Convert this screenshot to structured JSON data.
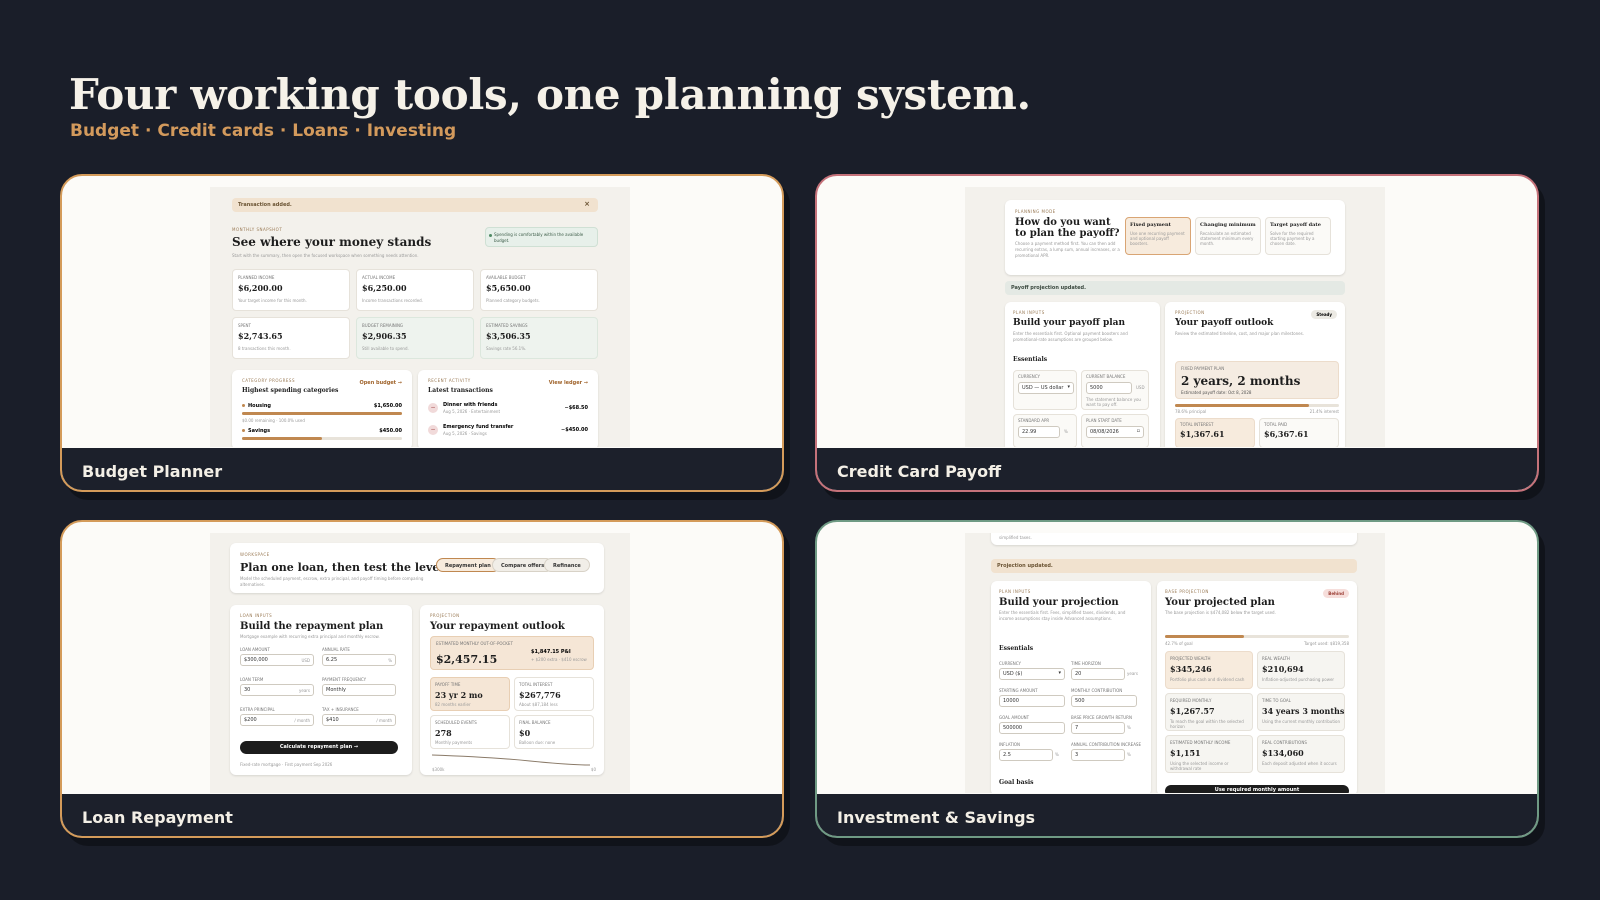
{
  "header": {
    "title": "Four working tools, one planning system.",
    "subtitle": "Budget · Credit cards · Loans · Investing"
  },
  "cards": [
    {
      "caption": "Budget Planner",
      "color": "#d49b5a"
    },
    {
      "caption": "Credit Card Payoff",
      "color": "#c5727a"
    },
    {
      "caption": "Loan Repayment",
      "color": "#d49b5a"
    },
    {
      "caption": "Investment & Savings",
      "color": "#6f9a84"
    }
  ],
  "budget": {
    "banner": "Transaction added.",
    "close": "×",
    "kicker": "Monthly snapshot",
    "title": "See where your money stands",
    "desc": "Start with the summary, then open the focused workspace when something needs attention.",
    "status": "Spending is comfortably within the available budget.",
    "stats": [
      {
        "label": "Planned income",
        "value": "$6,200.00",
        "note": "Your target income for this month."
      },
      {
        "label": "Actual income",
        "value": "$6,250.00",
        "note": "Income transactions recorded."
      },
      {
        "label": "Available budget",
        "value": "$5,650.00",
        "note": "Planned category budgets."
      },
      {
        "label": "Spent",
        "value": "$2,743.65",
        "note": "8 transactions this month."
      },
      {
        "label": "Budget remaining",
        "value": "$2,906.35",
        "note": "Still available to spend."
      },
      {
        "label": "Estimated savings",
        "value": "$3,506.35",
        "note": "Savings rate 56.1%."
      }
    ],
    "cat_kicker": "Category progress",
    "cat_title": "Highest spending categories",
    "cat_link": "Open budget →",
    "cats": [
      {
        "name": "Housing",
        "amount": "$1,650.00",
        "note": "$0.00 remaining · 100.0% used",
        "fill": 1.0
      },
      {
        "name": "Savings",
        "amount": "$450.00",
        "fill": 0.5
      }
    ],
    "act_kicker": "Recent activity",
    "act_title": "Latest transactions",
    "act_link": "View ledger →",
    "txns": [
      {
        "name": "Dinner with friends",
        "meta": "Aug 5, 2026 · Entertainment",
        "amount": "−$68.50"
      },
      {
        "name": "Emergency fund transfer",
        "meta": "Aug 5, 2026 · Savings",
        "amount": "−$450.00"
      }
    ]
  },
  "credit": {
    "kicker": "Planning mode",
    "title": "How do you want to plan the payoff?",
    "desc": "Choose a payment method first. You can then add recurring extras, a lump sum, annual increases, or a promotional APR.",
    "modes": [
      {
        "name": "Fixed payment",
        "desc": "Use one recurring payment and optional payoff boosters."
      },
      {
        "name": "Changing minimum",
        "desc": "Recalculate an estimated statement minimum every month."
      },
      {
        "name": "Target payoff date",
        "desc": "Solve for the required starting payment by a chosen date."
      }
    ],
    "banner": "Payoff projection updated.",
    "in_kicker": "Plan inputs",
    "in_title": "Build your payoff plan",
    "in_desc": "Enter the essentials first. Optional payment boosters and promotional-rate assumptions are grouped below.",
    "essentials": "Essentials",
    "fields": [
      {
        "label": "Currency",
        "value": "USD — US dollar"
      },
      {
        "label": "Current balance",
        "value": "5000",
        "unit": "USD"
      },
      {
        "label": "Standard APR",
        "value": "22.99",
        "unit": "%"
      },
      {
        "label": "Plan start date",
        "value": "08/08/2026"
      }
    ],
    "balance_note": "The statement balance you want to pay off.",
    "out_kicker": "Projection",
    "out_title": "Your payoff outlook",
    "out_badge": "Steady",
    "out_desc": "Review the estimated timeline, cost, and major plan milestones.",
    "plan_label": "Fixed payment plan",
    "plan_value": "2 years, 2 months",
    "plan_date": "Estimated payoff date: Oct 8, 2028",
    "progress": 0.82,
    "progress_left": "78.6% principal",
    "progress_right": "21.4% interest",
    "total_interest_label": "Total interest",
    "total_interest": "$1,367.61",
    "total_paid_label": "Total paid",
    "total_paid": "$6,367.61"
  },
  "loan": {
    "kicker": "Workspace",
    "title": "Plan one loan, then test the levers.",
    "desc": "Model the scheduled payment, escrow, extra principal, and payoff timing before comparing alternatives.",
    "tabs": [
      "Repayment plan",
      "Compare offers",
      "Refinance"
    ],
    "in_kicker": "Loan inputs",
    "in_title": "Build the repayment plan",
    "in_desc": "Mortgage example with recurring extra principal and monthly escrow.",
    "fields": [
      {
        "label": "Loan amount",
        "value": "$300,000",
        "unit": "USD"
      },
      {
        "label": "Annual rate",
        "value": "6.25",
        "unit": "%"
      },
      {
        "label": "Loan term",
        "value": "30",
        "unit": "years"
      },
      {
        "label": "Payment frequency",
        "value": "Monthly"
      },
      {
        "label": "Extra principal",
        "value": "$200",
        "unit": "/ month"
      },
      {
        "label": "Tax + insurance",
        "value": "$410",
        "unit": "/ month"
      }
    ],
    "button": "Calculate repayment plan →",
    "footnote": "Fixed-rate mortgage · First payment Sep 2026",
    "out_kicker": "Projection",
    "out_title": "Your repayment outlook",
    "est_label": "Estimated monthly out-of-pocket",
    "est_value": "$2,457.15",
    "pi": "$1,847.15 P&I",
    "pi_note": "+ $200 extra · $410 escrow",
    "stats": [
      {
        "label": "Payoff time",
        "value": "23 yr 2 mo",
        "note": "82 months earlier"
      },
      {
        "label": "Total interest",
        "value": "$267,776",
        "note": "About $87,184 less"
      },
      {
        "label": "Scheduled events",
        "value": "278",
        "note": "Monthly payments"
      },
      {
        "label": "Final balance",
        "value": "$0",
        "note": "Balloon due: none"
      }
    ],
    "axis_left": "$300k",
    "axis_right": "$0"
  },
  "invest": {
    "top_text": "simplified taxes.",
    "banner": "Projection updated.",
    "in_kicker": "Plan inputs",
    "in_title": "Build your projection",
    "in_desc": "Enter the essentials first. Fees, simplified taxes, dividends, and income assumptions stay inside Advanced assumptions.",
    "essentials": "Essentials",
    "fields": [
      {
        "label": "Currency",
        "value": "USD ($)"
      },
      {
        "label": "Time horizon",
        "value": "20",
        "unit": "years"
      },
      {
        "label": "Starting amount",
        "value": "10000"
      },
      {
        "label": "Monthly contribution",
        "value": "500"
      },
      {
        "label": "Goal amount",
        "value": "500000"
      },
      {
        "label": "Base price growth return",
        "value": "7",
        "unit": "%"
      },
      {
        "label": "Inflation",
        "value": "2.5",
        "unit": "%"
      },
      {
        "label": "Annual contribution increase",
        "value": "3",
        "unit": "%"
      }
    ],
    "goal_basis": "Goal basis",
    "out_kicker": "Base projection",
    "out_title": "Your projected plan",
    "out_badge": "Behind",
    "out_desc": "The base projection is $474,082 below the target used.",
    "progress": 0.43,
    "progress_left": "42.7% of goal",
    "progress_right": "Target used: $819,358",
    "stats": [
      {
        "label": "Projected wealth",
        "value": "$345,246",
        "note": "Portfolio plus cash and dividend cash"
      },
      {
        "label": "Real wealth",
        "value": "$210,694",
        "note": "Inflation-adjusted purchasing power"
      },
      {
        "label": "Required monthly",
        "value": "$1,267.57",
        "note": "To reach the goal within the selected horizon"
      },
      {
        "label": "Time to goal",
        "value": "34 years 3 months",
        "note": "Using the current monthly contribution"
      },
      {
        "label": "Estimated monthly income",
        "value": "$1,151",
        "note": "Using the selected income or withdrawal rate"
      },
      {
        "label": "Real contributions",
        "value": "$134,060",
        "note": "Each deposit adjusted when it occurs"
      }
    ],
    "button": "Use required monthly amount"
  }
}
